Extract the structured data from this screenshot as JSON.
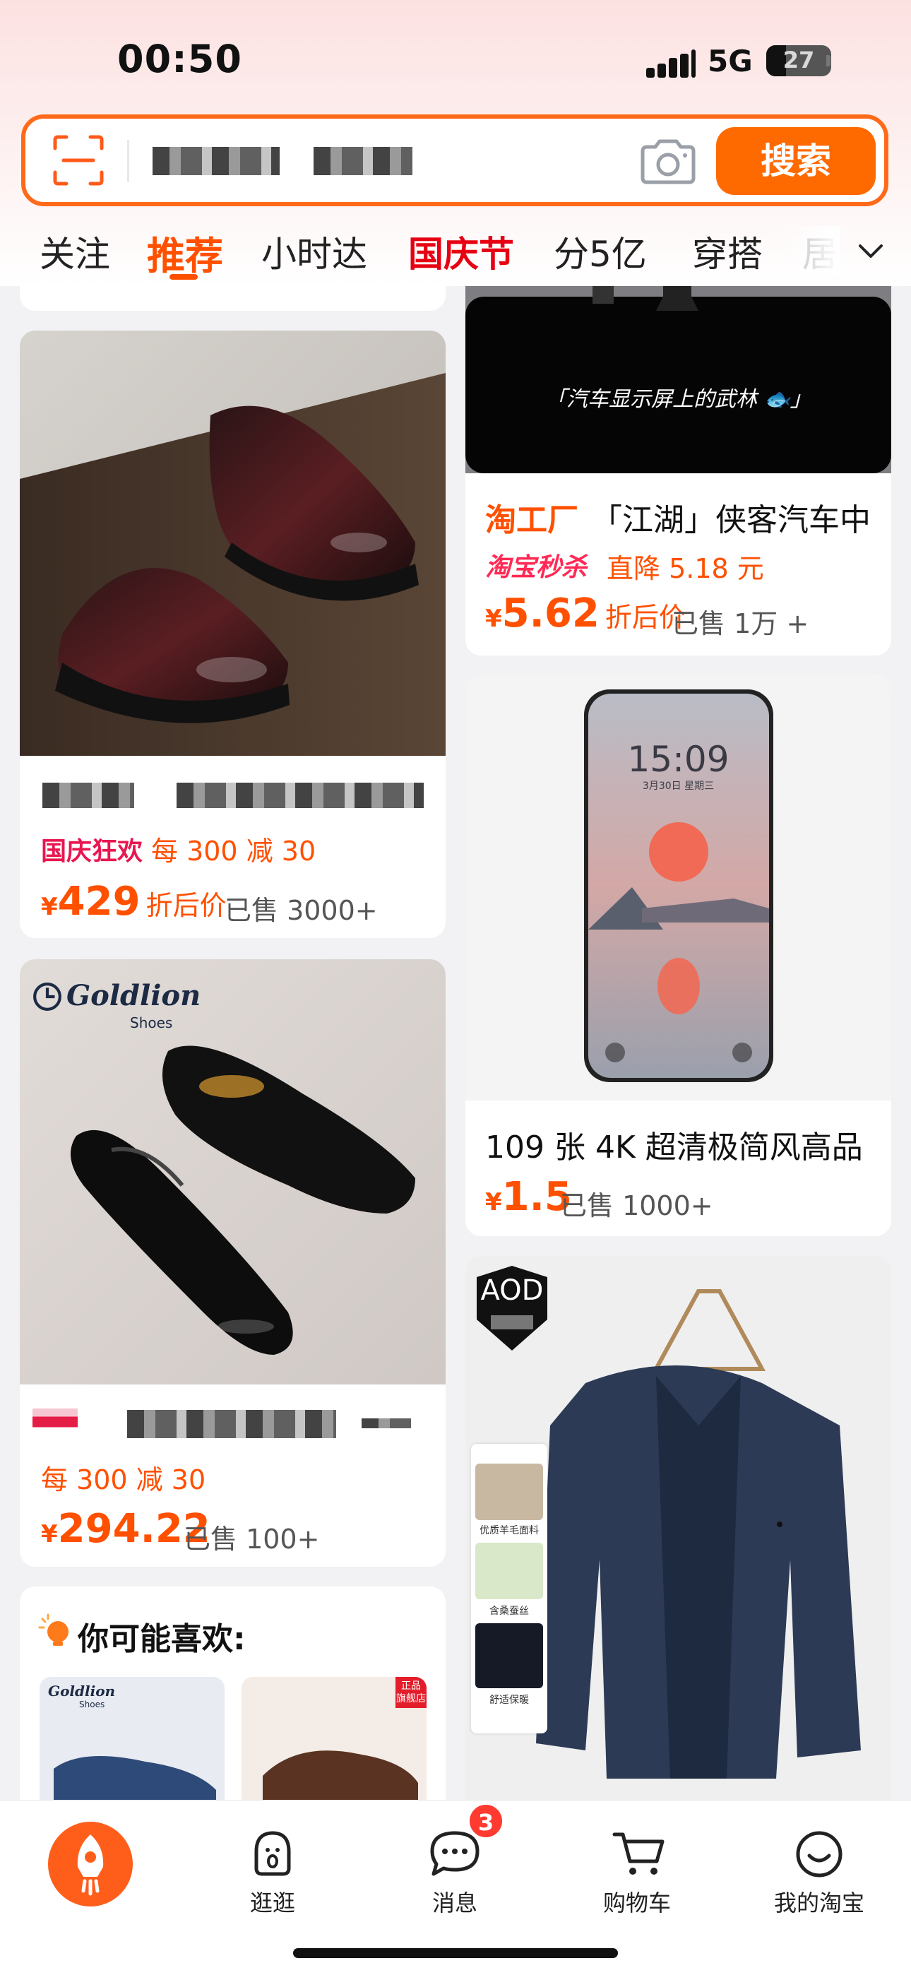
{
  "status_bar": {
    "time": "00:50",
    "network": "5G",
    "battery": "27"
  },
  "search": {
    "button_label": "搜索"
  },
  "tabs": [
    "关注",
    "推荐",
    "小时达",
    "国庆节",
    "分5亿",
    "穿搭",
    "居"
  ],
  "feed": {
    "left": {
      "shoe1": {
        "promo_tag": "国庆狂欢",
        "promo_text": "每 300 减 30",
        "yen": "¥",
        "price": "429",
        "price_label": "折后价",
        "sold": "已售 3000+"
      },
      "shoe2": {
        "brand": "Goldlion",
        "brand_sub": "Shoes",
        "promo_text": "每 300 减 30",
        "yen": "¥",
        "price": "294.22",
        "sold": "已售 100+"
      },
      "you_may_like": {
        "title": "你可能喜欢:",
        "thumb_brand": "Goldlion",
        "thumb_brand_sub": "Shoes",
        "thumb_badge": "正品\n旗舰店"
      }
    },
    "right": {
      "car": {
        "image_caption": "「汽车显示屏上的武林 🐟」",
        "title_tag": "淘工厂",
        "title": "「江湖」侠客汽车中",
        "promo_tag": "淘宝秒杀",
        "promo_text": "直降 5.18 元",
        "yen": "¥",
        "price": "5.62",
        "price_label": "折后价",
        "sold": "已售 1万 +"
      },
      "wallpaper": {
        "lock_time": "15:09",
        "lock_date": "3月30日 星期三",
        "title": "109 张 4K 超清极简风高品",
        "yen": "¥",
        "price": "1.5",
        "sold": "已售 1000+"
      },
      "jacket": {
        "brand": "AOD",
        "features": [
          "优质羊毛面料",
          "含桑蚕丝",
          "舒适保暖"
        ]
      }
    }
  },
  "bottom_nav": {
    "items": [
      "逛逛",
      "消息",
      "购物车",
      "我的淘宝"
    ],
    "messages_badge": "3"
  },
  "colors": {
    "accent": "#ff5000",
    "search_border": "#ff6a1a",
    "festival_red": "#e60012"
  }
}
